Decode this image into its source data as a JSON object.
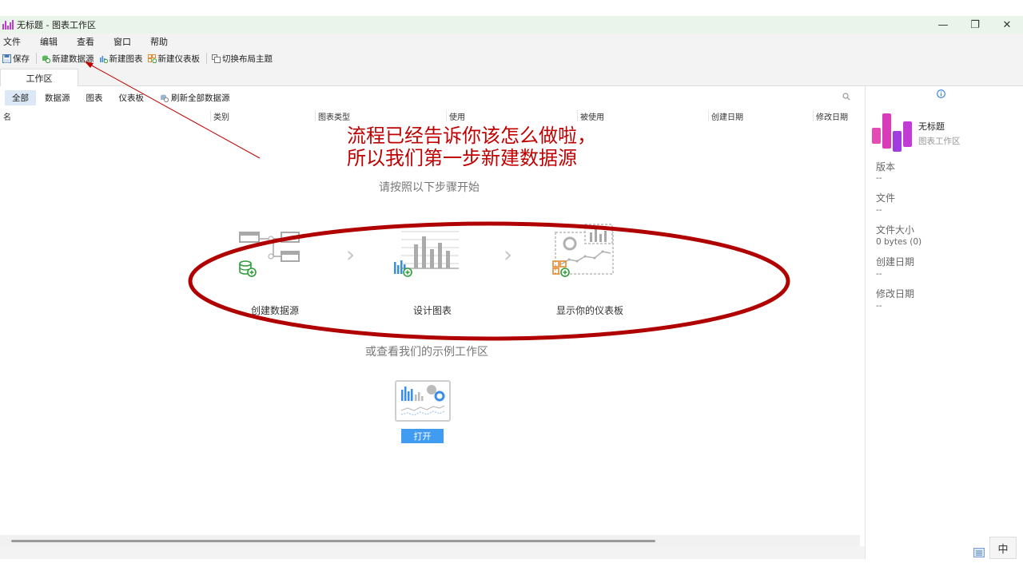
{
  "window": {
    "title": "无标题 - 图表工作区",
    "minimize": "—",
    "restore": "❐",
    "close": "✕"
  },
  "menu": [
    "文件",
    "编辑",
    "查看",
    "窗口",
    "帮助"
  ],
  "toolbar": {
    "save": "保存",
    "new_datasource": "新建数据源",
    "new_chart": "新建图表",
    "new_dashboard": "新建仪表板",
    "switch_theme": "切换布局主题"
  },
  "tab": {
    "label": "工作区"
  },
  "filters": {
    "all": "全部",
    "datasource": "数据源",
    "chart": "图表",
    "dashboard": "仪表板",
    "refresh": "刷新全部数据源"
  },
  "columns": [
    "名",
    "类别",
    "图表类型",
    "使用",
    "被使用",
    "创建日期",
    "修改日期"
  ],
  "annotation": {
    "line1": "流程已经告诉你该怎么做啦，",
    "line2": "所以我们第一步新建数据源",
    "color": "#c00000"
  },
  "steps": {
    "title": "请按照以下步骤开始",
    "step1": "创建数据源",
    "step2": "设计图表",
    "step3": "显示你的仪表板",
    "arrow": "›"
  },
  "example": {
    "title": "或查看我们的示例工作区",
    "open": "打开"
  },
  "panel": {
    "name": "无标题",
    "subtitle": "图表工作区",
    "version_label": "版本",
    "version_value": "--",
    "file_label": "文件",
    "file_value": "--",
    "size_label": "文件大小",
    "size_value": "0 bytes (0)",
    "created_label": "创建日期",
    "created_value": "--",
    "modified_label": "修改日期",
    "modified_value": "--"
  },
  "ime": "中",
  "colors": {
    "accent": "#3f9cf1",
    "brand": "#c23bd4",
    "annotation": "#c00000",
    "titlebar_bg": "#eaf4ea"
  }
}
